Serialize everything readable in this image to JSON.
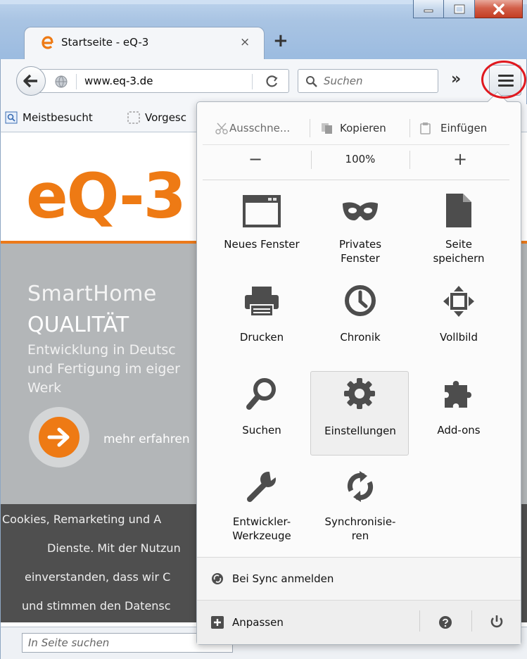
{
  "window": {
    "tab_title": "Startseite - eQ-3",
    "tab_close": "×",
    "new_tab": "+",
    "minimize_icon": "minimize-icon",
    "maximize_icon": "maximize-icon",
    "close_icon": "close-icon"
  },
  "navbar": {
    "url_prefix": "www.",
    "url_host": "eq-3.de",
    "reload": "C",
    "search_placeholder": "Suchen",
    "overflow": "»"
  },
  "bookmarks": {
    "items": [
      {
        "label": "Meistbesucht",
        "icon": "bookmark-page-icon"
      },
      {
        "label": "Vorgesc",
        "icon": "dashed-folder-icon"
      }
    ]
  },
  "page": {
    "logo": "eQ-3",
    "hero_title": "SmartHome",
    "hero_subtitle": "QUALITÄT",
    "hero_text_lines": [
      "Entwicklung in Deutsc",
      "und Fertigung im eiger",
      "Werk"
    ],
    "cta_label": "mehr erfahren",
    "cookie_lines": [
      "Cookies, Remarketing und A",
      "Dienste. Mit der Nutzun",
      "einverstanden, dass wir C",
      "und stimmen den Datensc"
    ],
    "accent_color": "#ee7a14",
    "findbar_placeholder": "In Seite suchen"
  },
  "menu": {
    "edit": {
      "cut": "Ausschne...",
      "copy": "Kopieren",
      "paste": "Einfügen"
    },
    "zoom": {
      "minus": "−",
      "level": "100%",
      "plus": "+"
    },
    "grid": [
      {
        "label": "Neues Fenster",
        "icon": "new-window-icon"
      },
      {
        "label": "Privates Fenster",
        "icon": "private-mask-icon"
      },
      {
        "label": "Seite speichern",
        "icon": "save-page-icon"
      },
      {
        "label": "Drucken",
        "icon": "printer-icon"
      },
      {
        "label": "Chronik",
        "icon": "history-clock-icon"
      },
      {
        "label": "Vollbild",
        "icon": "fullscreen-icon"
      },
      {
        "label": "Suchen",
        "icon": "search-icon"
      },
      {
        "label": "Einstellungen",
        "icon": "gear-icon"
      },
      {
        "label": "Add-ons",
        "icon": "puzzle-icon"
      },
      {
        "label": "Entwickler-Werkzeuge",
        "icon": "wrench-icon"
      },
      {
        "label": "Synchronisie-ren",
        "icon": "sync-icon"
      }
    ],
    "selected_item": "Einstellungen",
    "sync_signin": "Bei Sync anmelden",
    "customize": "Anpassen",
    "help_icon": "help-icon",
    "quit_icon": "power-icon"
  }
}
